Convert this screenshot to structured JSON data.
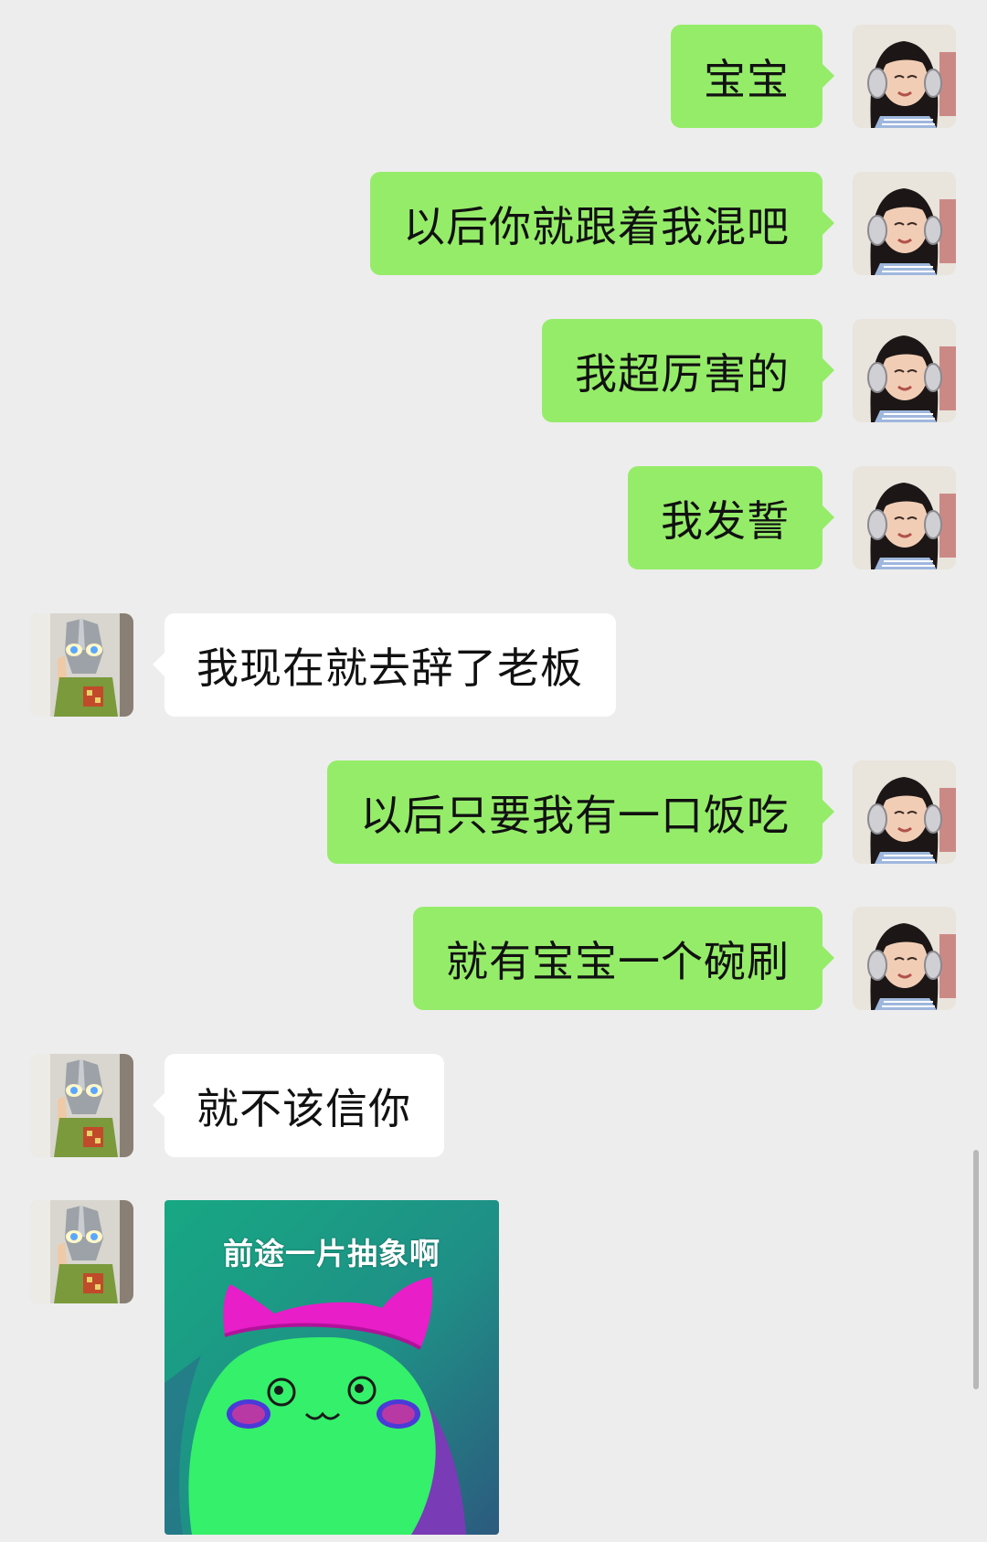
{
  "chat": {
    "messages": [
      {
        "side": "out",
        "text": "宝宝"
      },
      {
        "side": "out",
        "text": "以后你就跟着我混吧"
      },
      {
        "side": "out",
        "text": "我超厉害的"
      },
      {
        "side": "out",
        "text": "我发誓"
      },
      {
        "side": "in",
        "text": "我现在就去辞了老板"
      },
      {
        "side": "out",
        "text": "以后只要我有一口饭吃"
      },
      {
        "side": "out",
        "text": "就有宝宝一个碗刷"
      },
      {
        "side": "in",
        "text": "就不该信你"
      },
      {
        "side": "in",
        "type": "sticker",
        "caption": "前途一片抽象啊"
      }
    ]
  },
  "icons": {
    "self_avatar": "girl-with-headphones-avatar",
    "other_avatar": "ultraman-mask-avatar",
    "sticker": "green-cat-sticker"
  },
  "colors": {
    "background": "#ededed",
    "outgoing_bubble": "#95ec69",
    "incoming_bubble": "#ffffff",
    "text": "#111111",
    "sticker_bg": "#1f9a7c",
    "sticker_cat": "#34f06a",
    "sticker_ears": "#e81ec8"
  }
}
